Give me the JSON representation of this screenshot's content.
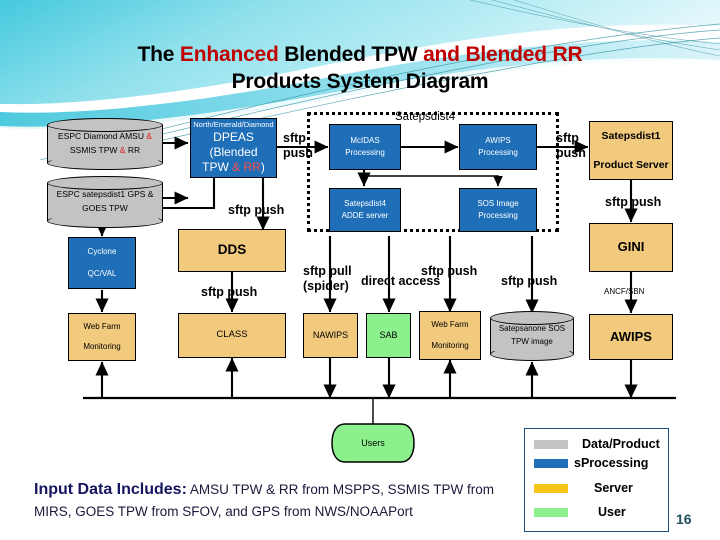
{
  "slide": {
    "title_line1_parts": [
      {
        "text": "The ",
        "red": false
      },
      {
        "text": "Enhanced",
        "red": true
      },
      {
        "text": " Blended TPW ",
        "red": false
      },
      {
        "text": "and Blended RR",
        "red": true
      }
    ],
    "title_line1_plain": "The Enhanced Blended TPW and Blended RR",
    "title_line2": "Products System Diagram",
    "page_number": "16"
  },
  "group": {
    "label": "Satepsdist4"
  },
  "nodes": {
    "espc_diamond": {
      "line1": "ESPC Diamond",
      "line2_parts": [
        {
          "text": "AMSU ",
          "red": false
        },
        {
          "text": "&",
          "red": true
        },
        {
          "text": " SSMIS TPW ",
          "red": false
        },
        {
          "text": "&",
          "red": true
        },
        {
          "text": " RR",
          "red": false
        }
      ],
      "line2_plain": "AMSU & SSMIS TPW & RR"
    },
    "espc_satepsdist1": {
      "line1": "ESPC satepsdist1",
      "line2": "GPS & GOES TPW"
    },
    "dpeas": {
      "header": "North/Emerald/Diamond",
      "line1": "DPEAS",
      "line2": "(Blended",
      "line3_parts": [
        {
          "text": "TPW ",
          "red": false
        },
        {
          "text": "& RR",
          "red": true
        },
        {
          "text": ")",
          "red": false
        }
      ],
      "line3_plain": "TPW & RR)"
    },
    "mcidas": {
      "line1": "McIDAS",
      "line2": "Processing"
    },
    "awips_proc": {
      "line1": "AWIPS",
      "line2": "Processing"
    },
    "satepsdist4_adde": {
      "line1": "Satepsdist4",
      "line2": "ADDE server"
    },
    "sos_image": {
      "line1": "SOS Image",
      "line2": "Processing"
    },
    "satepsdist1_product": {
      "line1": "Satepsdist1",
      "line2": "Product Server"
    },
    "gini": {
      "line1": "GINI"
    },
    "cyclone": {
      "line1": "Cyclone",
      "line2": "QC/VAL"
    },
    "dds": {
      "line1": "DDS"
    },
    "webfarm_mon_left": {
      "line1": "Web Farm",
      "line2": "Monitoring"
    },
    "class": {
      "line1": "CLASS"
    },
    "nawips": {
      "line1": "NAWIPS"
    },
    "sab": {
      "line1": "SAB"
    },
    "webfarm_mon_right": {
      "line1": "Web Farm",
      "line2": "Monitoring"
    },
    "satepsanone": {
      "line1": "Satepsanone",
      "line2": "SOS TPW image"
    },
    "awips": {
      "line1": "AWIPS"
    },
    "users": {
      "line1": "Users"
    }
  },
  "edge_labels": {
    "sftp_push_dpeas_to_mcidas": {
      "l1": "sftp",
      "l2": "push"
    },
    "sftp_push_awips_to_sat1": {
      "l1": "sftp",
      "l2": "push"
    },
    "sftp_push_dpeas_to_dds": {
      "text": "sftp push"
    },
    "sftp_push_dpeas_to_cyclone": {
      "text": "sftp  push"
    },
    "sftp_push_sat1_to_gini": {
      "text": "sftp push"
    },
    "sftp_push_dds_to_class": {
      "text": "sftp push"
    },
    "sftp_pull_spider": {
      "l1": "sftp pull",
      "l2": "(spider)"
    },
    "direct_access": {
      "text": "direct  access"
    },
    "sftp_push_webfarm": {
      "text": "sftp push"
    },
    "sftp_push_satepsanone": {
      "text": "sftp  push"
    },
    "ancf_sbn": {
      "text": "ANCF/SBN"
    }
  },
  "legend": {
    "items": [
      {
        "label": "Data/Product",
        "color": "#c3c3c3",
        "name": "data-product"
      },
      {
        "label": "sProcessing",
        "color": "#1f6fb8",
        "name": "processing"
      },
      {
        "label": "Server",
        "color": "#f5c518",
        "name": "server"
      },
      {
        "label": "User",
        "color": "#8cf08c",
        "name": "user"
      }
    ]
  },
  "footer": {
    "label": "Input Data Includes:",
    "body": " AMSU TPW & RR from MSPPS, SSMIS TPW from MIRS, GOES TPW from SFOV, and GPS from NWS/NOAAPort"
  },
  "colors": {
    "processing_blue": "#1f6fb8",
    "server_orange": "#f2ca7e",
    "user_green": "#8cf08c",
    "data_gray": "#c3c3c3",
    "title_red": "#c00000",
    "footer_navy": "#1a1a4a",
    "deco_cyan": "#3ec8e0"
  }
}
